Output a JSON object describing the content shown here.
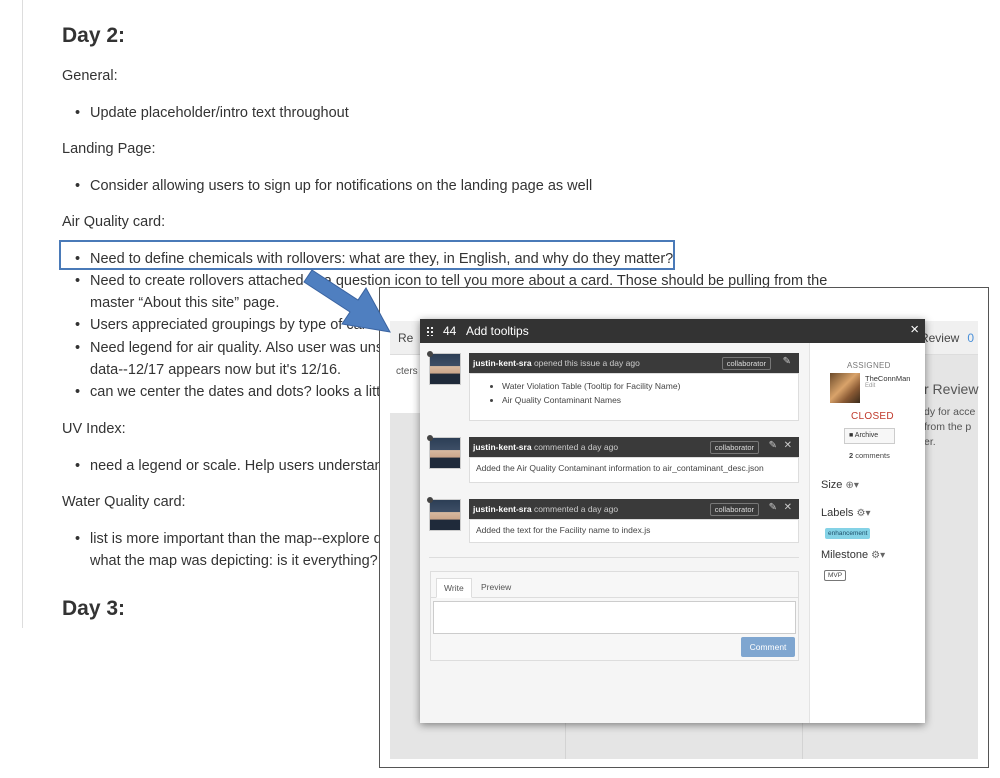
{
  "doc": {
    "day2_heading": "Day 2:",
    "general_label": "General:",
    "general_items": [
      "Update placeholder/intro text throughout"
    ],
    "landing_label": "Landing Page:",
    "landing_items": [
      "Consider allowing users to sign up for notifications on the landing page as well"
    ],
    "air_label": "Air Quality card:",
    "air_items": [
      "Need to define chemicals with rollovers: what are they, in English, and why do they matter?",
      "Need to create rollovers attached to a question icon to tell you more about a card. Those should be pulling from the",
      "master “About this site” page.",
      "Users appreciated groupings by type of card",
      "Need legend for air quality. Also user was unsure",
      "data--12/17 appears now but it's 12/16.",
      "can we center the dates and dots? looks a little"
    ],
    "uv_label": "UV Index:",
    "uv_items": [
      "need a legend or scale. Help users understand"
    ],
    "water_label": "Water Quality card:",
    "water_items": [
      "list is more important than the map--explore de",
      "what the map was depicting: is it everything? i"
    ],
    "day3_heading": "Day 3:"
  },
  "board": {
    "left_col_header": "Re",
    "left_card_text": "cters in",
    "right_col_header": "Review",
    "right_col_count": "0",
    "right_title": "r Review",
    "right_lines": [
      "dy for acce",
      "from the p",
      "er."
    ]
  },
  "modal": {
    "issue_number": "44",
    "title": "Add tooltips",
    "close": "×",
    "comments": [
      {
        "author": "justin-kent-sra",
        "verb": "opened this issue a day ago",
        "badge": "collaborator",
        "items": [
          "Water Violation Table (Tooltip for Facility Name)",
          "Air Quality Contaminant Names"
        ]
      },
      {
        "author": "justin-kent-sra",
        "verb": "commented a day ago",
        "badge": "collaborator",
        "text": "Added the Air Quality Contaminant information to air_contaminant_desc.json"
      },
      {
        "author": "justin-kent-sra",
        "verb": "commented a day ago",
        "badge": "collaborator",
        "text": "Added the text for the Facility name to index.js"
      }
    ],
    "editor": {
      "write_tab": "Write",
      "preview_tab": "Preview",
      "button": "Comment"
    },
    "sidebar": {
      "assigned_label": "ASSIGNED",
      "assignee": "TheConnMan",
      "assignee_edit": "Edit",
      "status": "CLOSED",
      "archive": "Archive",
      "comments_count": "2",
      "comments_word": "comments",
      "size_label": "Size",
      "labels_label": "Labels",
      "label_value": "enhancement",
      "milestone_label": "Milestone",
      "milestone_value": "MVP"
    }
  },
  "colors": {
    "highlight_border": "#4a7ab8",
    "arrow": "#4f7fc0",
    "closed": "#c0392b",
    "comment_button": "#7fa6d0",
    "label_pill": "#84d2e6"
  }
}
